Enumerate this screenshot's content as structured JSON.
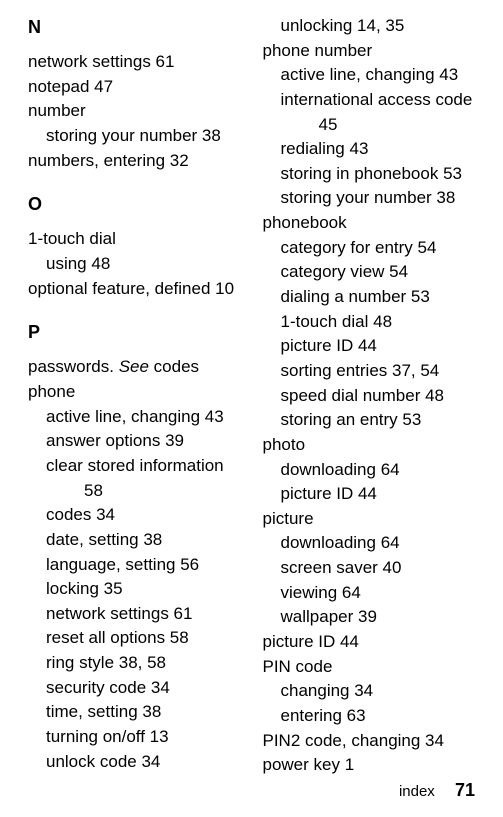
{
  "left": {
    "sectionN": "N",
    "n1": "network settings  61",
    "n2": "notepad  47",
    "n3": "number",
    "n3a": "storing your number  38",
    "n4": "numbers, entering  32",
    "sectionO": "O",
    "o1": "1-touch dial",
    "o1a": "using  48",
    "o2": "optional feature, defined  10",
    "sectionP": "P",
    "p1a": "passwords. ",
    "p1b": "See",
    "p1c": " codes",
    "p2": "phone",
    "p2a": "active line, changing  43",
    "p2b": "answer options  39",
    "p2c": "clear stored information  ",
    "p2c2": "58",
    "p2d": "codes  34",
    "p2e": "date, setting  38",
    "p2f": "language, setting  56",
    "p2g": "locking  35",
    "p2h": "network settings  61",
    "p2i": "reset all options  58",
    "p2j": "ring style  38, 58",
    "p2k": "security code  34",
    "p2l": "time, setting  38",
    "p2m": "turning on/off  13",
    "p2n": "unlock code  34"
  },
  "right": {
    "r1": "unlocking  14, 35",
    "r2": "phone number",
    "r2a": "active line, changing  43",
    "r2b": "international access code  ",
    "r2b2": "45",
    "r2c": "redialing  43",
    "r2d": "storing in phonebook  53",
    "r2e": "storing your number  38",
    "r3": "phonebook",
    "r3a": "category for entry  54",
    "r3b": "category view  54",
    "r3c": "dialing a number  53",
    "r3d": "1-touch dial  48",
    "r3e": "picture ID  44",
    "r3f": "sorting entries  37, 54",
    "r3g": "speed dial number  48",
    "r3h": "storing an entry  53",
    "r4": "photo",
    "r4a": "downloading  64",
    "r4b": "picture ID  44",
    "r5": "picture",
    "r5a": "downloading  64",
    "r5b": "screen saver  40",
    "r5c": "viewing  64",
    "r5d": "wallpaper  39",
    "r6": "picture ID  44",
    "r7": "PIN code",
    "r7a": "changing  34",
    "r7b": "entering  63",
    "r8": "PIN2 code, changing  34",
    "r9": "power key  1"
  },
  "footer": {
    "label": "index",
    "page": "71"
  }
}
